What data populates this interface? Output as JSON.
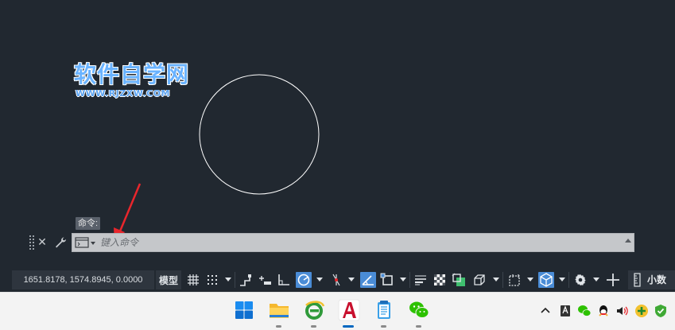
{
  "canvas": {
    "watermark_title": "软件自学网",
    "watermark_url": "WWW.RJZXW.COM",
    "command_tooltip": "命令:"
  },
  "command_line": {
    "close_glyph": "✕",
    "placeholder": "键入命令"
  },
  "status_bar": {
    "coordinates": "1651.8178, 1574.8945, 0.0000",
    "model_label": "模型",
    "units_label": "小数",
    "icons": [
      "grid-icon",
      "snap-mode-icon",
      "infer-constraints-icon",
      "dynamic-input-icon",
      "ortho-icon",
      "polar-tracking-icon",
      "isometric-icon",
      "object-snap-tracking-icon",
      "object-snap-icon",
      "lineweight-icon",
      "transparency-icon",
      "selection-cycling-icon",
      "3d-object-snap-icon",
      "annotation-scale-icon",
      "workspace-icon",
      "customization-icon",
      "plus-icon",
      "units-icon"
    ],
    "active_color": "#4a8cd6"
  },
  "taskbar": {
    "apps": [
      "windows-start-icon",
      "file-explorer-icon",
      "ie-browser-icon",
      "autocad-icon",
      "notepad-icon",
      "wechat-icon"
    ],
    "tray": [
      "chevron-up-icon",
      "ime-icon",
      "wechat-tray-icon",
      "qq-icon",
      "volume-icon",
      "security-plus-icon",
      "shield-icon"
    ]
  }
}
